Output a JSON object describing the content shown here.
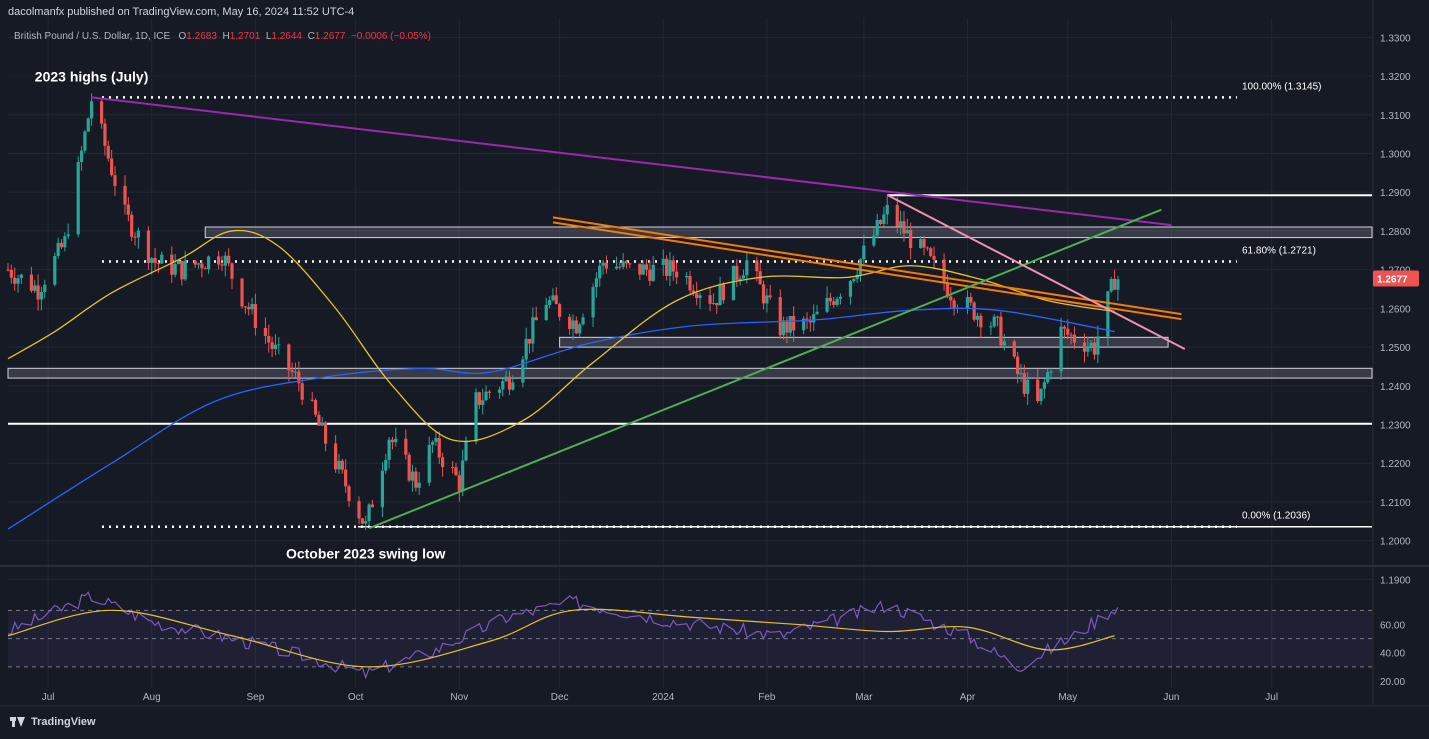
{
  "header": {
    "published": "dacolmanfx published on TradingView.com, May 16, 2024 11:52 UTC-4",
    "symbol": "British Pound / U.S. Dollar, 1D, ICE",
    "o_key": "O",
    "o_val": "1.2683",
    "h_key": "H",
    "h_val": "1.2701",
    "l_key": "L",
    "l_val": "1.2644",
    "c_key": "C",
    "c_val": "1.2677",
    "change": "−0.0006 (−0.05%)"
  },
  "footer": {
    "brand": "TradingView"
  },
  "colors": {
    "background": "#161a25",
    "bull": "#26a69a",
    "bear": "#ef5350",
    "ma_fast": "#e6c229",
    "ma_slow": "#2962ff",
    "trend_purple": "#9c27b0",
    "trend_orange": "#f57c00",
    "trend_green": "#4caf50",
    "trend_pink": "#f48fb1",
    "rsi": "#7e57c2",
    "price_tag": "#ef5350"
  },
  "chart_data": {
    "type": "candlestick",
    "instrument": "British Pound / U.S. Dollar",
    "timeframe": "1D",
    "last_price": "1.2677",
    "ylim": [
      1.195,
      1.335
    ],
    "price_ticks": [
      "1.3300",
      "1.3200",
      "1.3100",
      "1.3000",
      "1.2900",
      "1.2800",
      "1.2700",
      "1.2600",
      "1.2500",
      "1.2400",
      "1.2300",
      "1.2200",
      "1.2100",
      "1.2000",
      "1.1900"
    ],
    "x_ticks": [
      "Jul",
      "Aug",
      "Sep",
      "Oct",
      "Nov",
      "Dec",
      "2024",
      "Feb",
      "Mar",
      "Apr",
      "May",
      "Jun",
      "Jul"
    ],
    "rsi_ticks": [
      "60.00",
      "40.00",
      "20.00"
    ],
    "rsi_ylim": [
      15,
      95
    ],
    "rsi_bands": [
      30,
      50,
      70
    ],
    "annotations": [
      {
        "text": "2023 highs (July)",
        "date": "2023-07-14",
        "price": 1.3145
      },
      {
        "text": "October 2023 swing low",
        "date": "2023-10-04",
        "price": 1.2036
      }
    ],
    "fibonacci": [
      {
        "label": "100.00% (1.3145)",
        "price": 1.3145
      },
      {
        "label": "61.80% (1.2721)",
        "price": 1.2721
      },
      {
        "label": "0.00% (1.2036)",
        "price": 1.2036
      }
    ],
    "horizontal_levels": [
      1.2892,
      1.2302
    ],
    "zones": [
      {
        "from": "2023-08-17",
        "to": "2024-07-31",
        "low": 1.2788,
        "high": 1.2805
      },
      {
        "from": "2023-12-01",
        "to": "2024-05-31",
        "low": 1.2505,
        "high": 1.252
      },
      {
        "from": "2023-06-19",
        "to": "2024-07-31",
        "low": 1.2425,
        "high": 1.244
      }
    ],
    "trendlines": [
      {
        "name": "purple",
        "from": [
          "2023-07-14",
          1.3145
        ],
        "to": [
          "2024-06-01",
          1.2815
        ]
      },
      {
        "name": "orange",
        "from": [
          "2023-11-29",
          1.2835
        ],
        "to": [
          "2024-06-04",
          1.2585
        ]
      },
      {
        "name": "green",
        "from": [
          "2023-10-05",
          1.2032
        ],
        "to": [
          "2024-05-29",
          1.2855
        ]
      },
      {
        "name": "pink",
        "from": [
          "2024-03-08",
          1.2893
        ],
        "to": [
          "2024-06-05",
          1.2495
        ]
      }
    ],
    "ma_fast_points": [
      [
        "2023-06-19",
        1.247
      ],
      [
        "2023-07-03",
        1.254
      ],
      [
        "2023-07-20",
        1.264
      ],
      [
        "2023-08-10",
        1.273
      ],
      [
        "2023-08-25",
        1.28
      ],
      [
        "2023-09-08",
        1.276
      ],
      [
        "2023-09-25",
        1.26
      ],
      [
        "2023-10-12",
        1.24
      ],
      [
        "2023-10-30",
        1.226
      ],
      [
        "2023-11-20",
        1.231
      ],
      [
        "2023-12-11",
        1.246
      ],
      [
        "2024-01-05",
        1.262
      ],
      [
        "2024-01-30",
        1.268
      ],
      [
        "2024-02-25",
        1.268
      ],
      [
        "2024-03-15",
        1.271
      ],
      [
        "2024-04-05",
        1.2675
      ],
      [
        "2024-04-25",
        1.262
      ],
      [
        "2024-05-15",
        1.2592
      ]
    ],
    "ma_slow_points": [
      [
        "2023-06-19",
        1.203
      ],
      [
        "2023-07-20",
        1.22
      ],
      [
        "2023-08-20",
        1.236
      ],
      [
        "2023-09-20",
        1.242
      ],
      [
        "2023-10-20",
        1.2445
      ],
      [
        "2023-11-10",
        1.2435
      ],
      [
        "2023-12-10",
        1.251
      ],
      [
        "2024-01-10",
        1.2555
      ],
      [
        "2024-02-15",
        1.257
      ],
      [
        "2024-03-15",
        1.2595
      ],
      [
        "2024-04-10",
        1.2595
      ],
      [
        "2024-05-15",
        1.254
      ]
    ],
    "rsi_points": [
      [
        "2023-06-19",
        55
      ],
      [
        "2023-07-14",
        80
      ],
      [
        "2023-08-01",
        62
      ],
      [
        "2023-08-25",
        50
      ],
      [
        "2023-09-15",
        38
      ],
      [
        "2023-10-04",
        25
      ],
      [
        "2023-10-25",
        42
      ],
      [
        "2023-11-15",
        65
      ],
      [
        "2023-12-05",
        76
      ],
      [
        "2024-01-05",
        62
      ],
      [
        "2024-02-05",
        52
      ],
      [
        "2024-03-08",
        74
      ],
      [
        "2024-04-01",
        52
      ],
      [
        "2024-04-16",
        30
      ],
      [
        "2024-05-03",
        52
      ],
      [
        "2024-05-15",
        72
      ]
    ],
    "rsi_ma_points": [
      [
        "2023-06-19",
        52
      ],
      [
        "2023-07-20",
        70
      ],
      [
        "2023-08-25",
        52
      ],
      [
        "2023-10-04",
        30
      ],
      [
        "2023-11-10",
        48
      ],
      [
        "2023-12-05",
        70
      ],
      [
        "2024-01-10",
        65
      ],
      [
        "2024-02-10",
        60
      ],
      [
        "2024-03-08",
        55
      ],
      [
        "2024-04-01",
        58
      ],
      [
        "2024-04-25",
        42
      ],
      [
        "2024-05-15",
        52
      ]
    ]
  }
}
